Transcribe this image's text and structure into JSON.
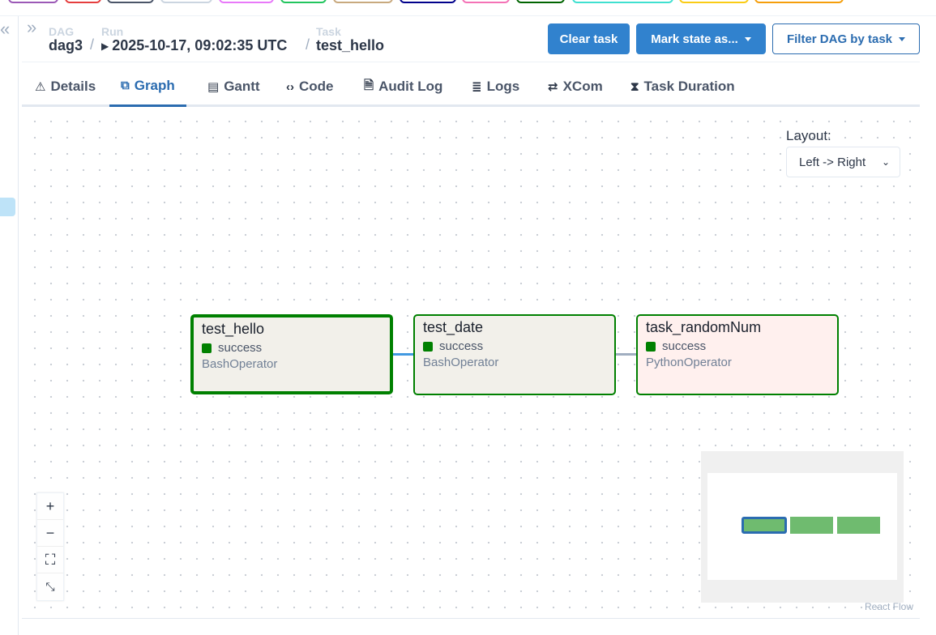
{
  "legend": {
    "pill_colors": [
      "#9b59b6",
      "#e53e3e",
      "#4a5568",
      "#cbd5e0",
      "#e879f9",
      "#22c55e",
      "#c8a97e",
      "#00008b",
      "#f472b6",
      "#006400",
      "#40e0d0",
      "#facc15",
      "#f59e0b"
    ]
  },
  "breadcrumb": {
    "dag_label": "DAG",
    "dag_value": "dag3",
    "run_label": "Run",
    "run_value": "2025-10-17, 09:02:35 UTC",
    "task_label": "Task",
    "task_value": "test_hello",
    "separator": "/"
  },
  "actions": {
    "clear_task": "Clear task",
    "mark_state": "Mark state as...",
    "filter_dag": "Filter DAG by task"
  },
  "tabs": [
    {
      "label": "Details",
      "icon": "warning-icon",
      "glyph": "⚠"
    },
    {
      "label": "Graph",
      "icon": "graph-icon",
      "glyph": "⧉"
    },
    {
      "label": "Gantt",
      "icon": "gantt-icon",
      "glyph": "▤"
    },
    {
      "label": "Code",
      "icon": "code-icon",
      "glyph": "‹›"
    },
    {
      "label": "Audit Log",
      "icon": "audit-log-icon",
      "glyph": "🗎"
    },
    {
      "label": "Logs",
      "icon": "logs-icon",
      "glyph": "≣"
    },
    {
      "label": "XCom",
      "icon": "xcom-icon",
      "glyph": "⇄"
    },
    {
      "label": "Task Duration",
      "icon": "hourglass-icon",
      "glyph": "⧗"
    }
  ],
  "active_tab": "Graph",
  "graph": {
    "layout_label": "Layout:",
    "layout_value": "Left -> Right",
    "nodes": [
      {
        "name": "test_hello",
        "state": "success",
        "operator": "BashOperator",
        "selected": true,
        "bg": "#f2f0ea"
      },
      {
        "name": "test_date",
        "state": "success",
        "operator": "BashOperator",
        "selected": false,
        "bg": "#f2f0ea"
      },
      {
        "name": "task_randomNum",
        "state": "success",
        "operator": "PythonOperator",
        "selected": false,
        "bg": "#fff0ee"
      }
    ],
    "state_color": "#008000",
    "attribution": "React Flow"
  },
  "controls": {
    "zoom_in": "+",
    "zoom_out": "−",
    "fit_view": "⛶",
    "toggle_interactivity": "⤡"
  }
}
